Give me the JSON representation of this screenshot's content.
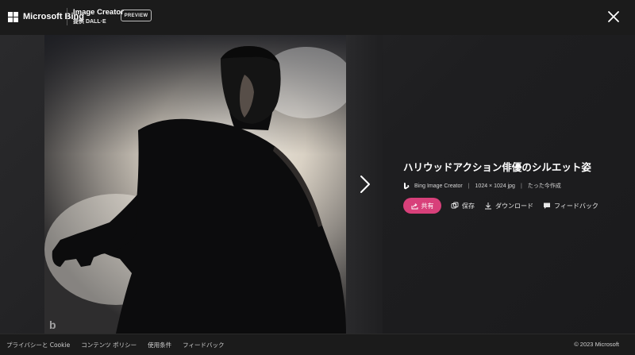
{
  "header": {
    "brand": "Microsoft Bing",
    "product_title": "Image Creator",
    "product_subtitle": "提供 DALL·E",
    "preview_badge": "PREVIEW"
  },
  "image": {
    "title": "ハリウッドアクション俳優のシルエット姿",
    "watermark": "b",
    "source": "Bing Image Creator",
    "dimensions": "1024 × 1024 jpg",
    "created": "たった今作成"
  },
  "actions": {
    "share": "共有",
    "save": "保存",
    "download": "ダウンロード",
    "feedback": "フィードバック"
  },
  "footer": {
    "links": [
      "プライバシーと Cookie",
      "コンテンツ ポリシー",
      "使用条件",
      "フィードバック"
    ],
    "copyright": "© 2023 Microsoft"
  },
  "colors": {
    "accent": "#d8407a",
    "header_bg": "#1b1b1b",
    "text": "#ffffff"
  },
  "icons": [
    "microsoft-logo-icon",
    "close-icon",
    "chevron-right-icon",
    "bing-logo-icon",
    "share-icon",
    "save-icon",
    "download-icon",
    "feedback-icon"
  ]
}
